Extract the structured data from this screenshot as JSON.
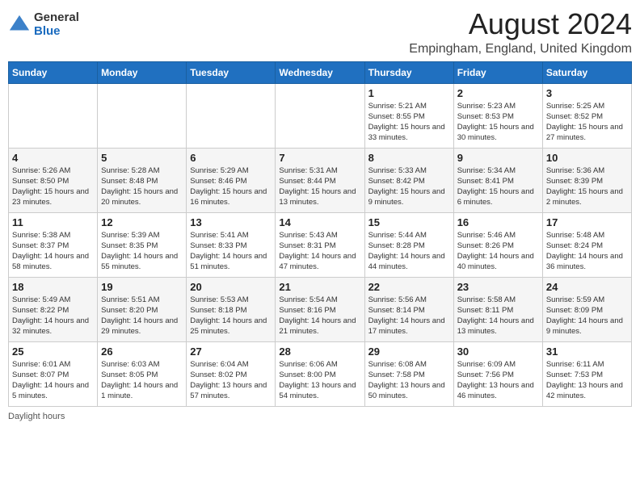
{
  "header": {
    "logo_general": "General",
    "logo_blue": "Blue",
    "title": "August 2024",
    "location": "Empingham, England, United Kingdom"
  },
  "days_of_week": [
    "Sunday",
    "Monday",
    "Tuesday",
    "Wednesday",
    "Thursday",
    "Friday",
    "Saturday"
  ],
  "weeks": [
    [
      {
        "day": "",
        "info": ""
      },
      {
        "day": "",
        "info": ""
      },
      {
        "day": "",
        "info": ""
      },
      {
        "day": "",
        "info": ""
      },
      {
        "day": "1",
        "sunrise": "Sunrise: 5:21 AM",
        "sunset": "Sunset: 8:55 PM",
        "daylight": "Daylight: 15 hours and 33 minutes."
      },
      {
        "day": "2",
        "sunrise": "Sunrise: 5:23 AM",
        "sunset": "Sunset: 8:53 PM",
        "daylight": "Daylight: 15 hours and 30 minutes."
      },
      {
        "day": "3",
        "sunrise": "Sunrise: 5:25 AM",
        "sunset": "Sunset: 8:52 PM",
        "daylight": "Daylight: 15 hours and 27 minutes."
      }
    ],
    [
      {
        "day": "4",
        "sunrise": "Sunrise: 5:26 AM",
        "sunset": "Sunset: 8:50 PM",
        "daylight": "Daylight: 15 hours and 23 minutes."
      },
      {
        "day": "5",
        "sunrise": "Sunrise: 5:28 AM",
        "sunset": "Sunset: 8:48 PM",
        "daylight": "Daylight: 15 hours and 20 minutes."
      },
      {
        "day": "6",
        "sunrise": "Sunrise: 5:29 AM",
        "sunset": "Sunset: 8:46 PM",
        "daylight": "Daylight: 15 hours and 16 minutes."
      },
      {
        "day": "7",
        "sunrise": "Sunrise: 5:31 AM",
        "sunset": "Sunset: 8:44 PM",
        "daylight": "Daylight: 15 hours and 13 minutes."
      },
      {
        "day": "8",
        "sunrise": "Sunrise: 5:33 AM",
        "sunset": "Sunset: 8:42 PM",
        "daylight": "Daylight: 15 hours and 9 minutes."
      },
      {
        "day": "9",
        "sunrise": "Sunrise: 5:34 AM",
        "sunset": "Sunset: 8:41 PM",
        "daylight": "Daylight: 15 hours and 6 minutes."
      },
      {
        "day": "10",
        "sunrise": "Sunrise: 5:36 AM",
        "sunset": "Sunset: 8:39 PM",
        "daylight": "Daylight: 15 hours and 2 minutes."
      }
    ],
    [
      {
        "day": "11",
        "sunrise": "Sunrise: 5:38 AM",
        "sunset": "Sunset: 8:37 PM",
        "daylight": "Daylight: 14 hours and 58 minutes."
      },
      {
        "day": "12",
        "sunrise": "Sunrise: 5:39 AM",
        "sunset": "Sunset: 8:35 PM",
        "daylight": "Daylight: 14 hours and 55 minutes."
      },
      {
        "day": "13",
        "sunrise": "Sunrise: 5:41 AM",
        "sunset": "Sunset: 8:33 PM",
        "daylight": "Daylight: 14 hours and 51 minutes."
      },
      {
        "day": "14",
        "sunrise": "Sunrise: 5:43 AM",
        "sunset": "Sunset: 8:31 PM",
        "daylight": "Daylight: 14 hours and 47 minutes."
      },
      {
        "day": "15",
        "sunrise": "Sunrise: 5:44 AM",
        "sunset": "Sunset: 8:28 PM",
        "daylight": "Daylight: 14 hours and 44 minutes."
      },
      {
        "day": "16",
        "sunrise": "Sunrise: 5:46 AM",
        "sunset": "Sunset: 8:26 PM",
        "daylight": "Daylight: 14 hours and 40 minutes."
      },
      {
        "day": "17",
        "sunrise": "Sunrise: 5:48 AM",
        "sunset": "Sunset: 8:24 PM",
        "daylight": "Daylight: 14 hours and 36 minutes."
      }
    ],
    [
      {
        "day": "18",
        "sunrise": "Sunrise: 5:49 AM",
        "sunset": "Sunset: 8:22 PM",
        "daylight": "Daylight: 14 hours and 32 minutes."
      },
      {
        "day": "19",
        "sunrise": "Sunrise: 5:51 AM",
        "sunset": "Sunset: 8:20 PM",
        "daylight": "Daylight: 14 hours and 29 minutes."
      },
      {
        "day": "20",
        "sunrise": "Sunrise: 5:53 AM",
        "sunset": "Sunset: 8:18 PM",
        "daylight": "Daylight: 14 hours and 25 minutes."
      },
      {
        "day": "21",
        "sunrise": "Sunrise: 5:54 AM",
        "sunset": "Sunset: 8:16 PM",
        "daylight": "Daylight: 14 hours and 21 minutes."
      },
      {
        "day": "22",
        "sunrise": "Sunrise: 5:56 AM",
        "sunset": "Sunset: 8:14 PM",
        "daylight": "Daylight: 14 hours and 17 minutes."
      },
      {
        "day": "23",
        "sunrise": "Sunrise: 5:58 AM",
        "sunset": "Sunset: 8:11 PM",
        "daylight": "Daylight: 14 hours and 13 minutes."
      },
      {
        "day": "24",
        "sunrise": "Sunrise: 5:59 AM",
        "sunset": "Sunset: 8:09 PM",
        "daylight": "Daylight: 14 hours and 9 minutes."
      }
    ],
    [
      {
        "day": "25",
        "sunrise": "Sunrise: 6:01 AM",
        "sunset": "Sunset: 8:07 PM",
        "daylight": "Daylight: 14 hours and 5 minutes."
      },
      {
        "day": "26",
        "sunrise": "Sunrise: 6:03 AM",
        "sunset": "Sunset: 8:05 PM",
        "daylight": "Daylight: 14 hours and 1 minute."
      },
      {
        "day": "27",
        "sunrise": "Sunrise: 6:04 AM",
        "sunset": "Sunset: 8:02 PM",
        "daylight": "Daylight: 13 hours and 57 minutes."
      },
      {
        "day": "28",
        "sunrise": "Sunrise: 6:06 AM",
        "sunset": "Sunset: 8:00 PM",
        "daylight": "Daylight: 13 hours and 54 minutes."
      },
      {
        "day": "29",
        "sunrise": "Sunrise: 6:08 AM",
        "sunset": "Sunset: 7:58 PM",
        "daylight": "Daylight: 13 hours and 50 minutes."
      },
      {
        "day": "30",
        "sunrise": "Sunrise: 6:09 AM",
        "sunset": "Sunset: 7:56 PM",
        "daylight": "Daylight: 13 hours and 46 minutes."
      },
      {
        "day": "31",
        "sunrise": "Sunrise: 6:11 AM",
        "sunset": "Sunset: 7:53 PM",
        "daylight": "Daylight: 13 hours and 42 minutes."
      }
    ]
  ],
  "footer": {
    "note": "Daylight hours"
  }
}
